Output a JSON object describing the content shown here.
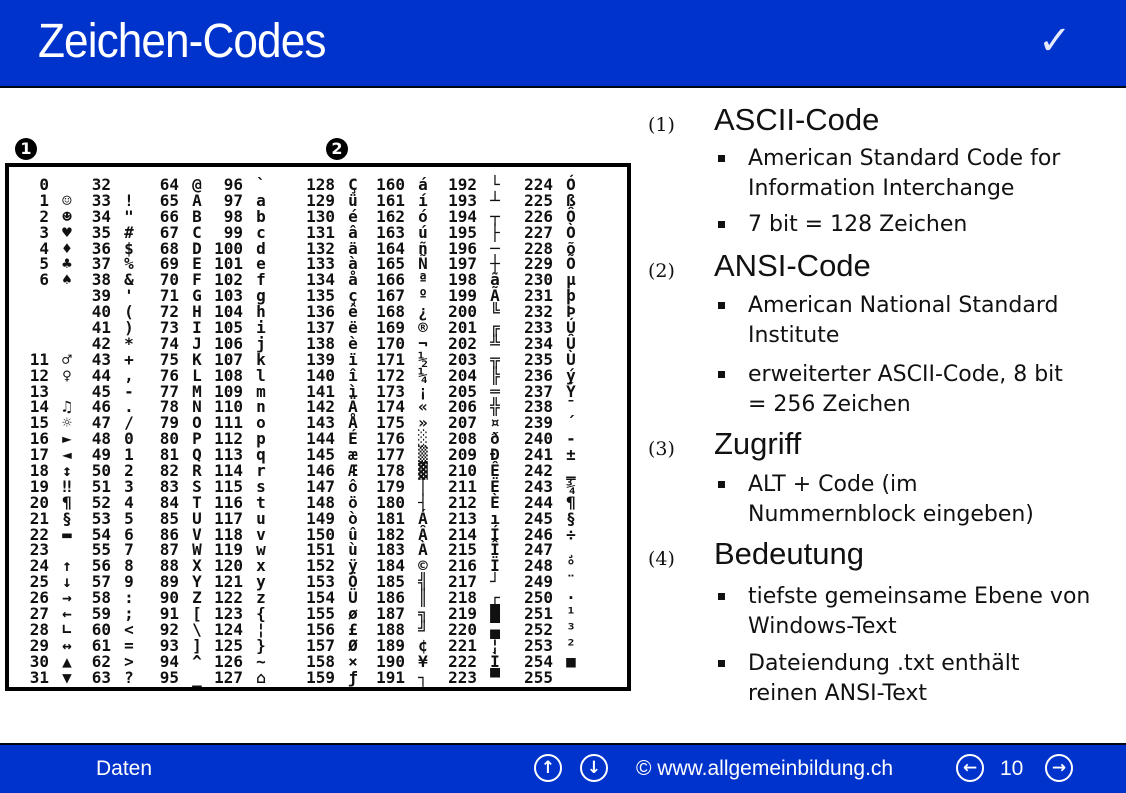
{
  "header": {
    "title": "Zeichen-Codes",
    "check_icon": "✓"
  },
  "markers": {
    "ascii": "1",
    "ansi": "2"
  },
  "code_table": {
    "columns": [
      [
        [
          "0",
          ""
        ],
        [
          "1",
          "☺"
        ],
        [
          "2",
          "☻"
        ],
        [
          "3",
          "♥"
        ],
        [
          "4",
          "♦"
        ],
        [
          "5",
          "♣"
        ],
        [
          "6",
          "♠"
        ],
        [
          "",
          ""
        ],
        [
          "",
          ""
        ],
        [
          "",
          ""
        ],
        [
          "",
          ""
        ],
        [
          "11",
          "♂"
        ],
        [
          "12",
          "♀"
        ],
        [
          "13",
          ""
        ],
        [
          "14",
          "♫"
        ],
        [
          "15",
          "☼"
        ],
        [
          "16",
          "►"
        ],
        [
          "17",
          "◄"
        ],
        [
          "18",
          "↕"
        ],
        [
          "19",
          "‼"
        ],
        [
          "20",
          "¶"
        ],
        [
          "21",
          "§"
        ],
        [
          "22",
          "▬"
        ],
        [
          "23",
          ""
        ],
        [
          "24",
          "↑"
        ],
        [
          "25",
          "↓"
        ],
        [
          "26",
          "→"
        ],
        [
          "27",
          "←"
        ],
        [
          "28",
          "∟"
        ],
        [
          "29",
          "↔"
        ],
        [
          "30",
          "▲"
        ],
        [
          "31",
          "▼"
        ]
      ],
      [
        [
          "32",
          ""
        ],
        [
          "33",
          "!"
        ],
        [
          "34",
          "\""
        ],
        [
          "35",
          "#"
        ],
        [
          "36",
          "$"
        ],
        [
          "37",
          "%"
        ],
        [
          "38",
          "&"
        ],
        [
          "39",
          "'"
        ],
        [
          "40",
          "("
        ],
        [
          "41",
          ")"
        ],
        [
          "42",
          "*"
        ],
        [
          "43",
          "+"
        ],
        [
          "44",
          ","
        ],
        [
          "45",
          "-"
        ],
        [
          "46",
          "."
        ],
        [
          "47",
          "/"
        ],
        [
          "48",
          "0"
        ],
        [
          "49",
          "1"
        ],
        [
          "50",
          "2"
        ],
        [
          "51",
          "3"
        ],
        [
          "52",
          "4"
        ],
        [
          "53",
          "5"
        ],
        [
          "54",
          "6"
        ],
        [
          "55",
          "7"
        ],
        [
          "56",
          "8"
        ],
        [
          "57",
          "9"
        ],
        [
          "58",
          ":"
        ],
        [
          "59",
          ";"
        ],
        [
          "60",
          "<"
        ],
        [
          "61",
          "="
        ],
        [
          "62",
          ">"
        ],
        [
          "63",
          "?"
        ]
      ],
      [
        [
          "64",
          "@"
        ],
        [
          "65",
          "A"
        ],
        [
          "66",
          "B"
        ],
        [
          "67",
          "C"
        ],
        [
          "68",
          "D"
        ],
        [
          "69",
          "E"
        ],
        [
          "70",
          "F"
        ],
        [
          "71",
          "G"
        ],
        [
          "72",
          "H"
        ],
        [
          "73",
          "I"
        ],
        [
          "74",
          "J"
        ],
        [
          "75",
          "K"
        ],
        [
          "76",
          "L"
        ],
        [
          "77",
          "M"
        ],
        [
          "78",
          "N"
        ],
        [
          "79",
          "O"
        ],
        [
          "80",
          "P"
        ],
        [
          "81",
          "Q"
        ],
        [
          "82",
          "R"
        ],
        [
          "83",
          "S"
        ],
        [
          "84",
          "T"
        ],
        [
          "85",
          "U"
        ],
        [
          "86",
          "V"
        ],
        [
          "87",
          "W"
        ],
        [
          "88",
          "X"
        ],
        [
          "89",
          "Y"
        ],
        [
          "90",
          "Z"
        ],
        [
          "91",
          "["
        ],
        [
          "92",
          "\\"
        ],
        [
          "93",
          "]"
        ],
        [
          "94",
          "^"
        ],
        [
          "95",
          "_"
        ]
      ],
      [
        [
          "96",
          "`"
        ],
        [
          "97",
          "a"
        ],
        [
          "98",
          "b"
        ],
        [
          "99",
          "c"
        ],
        [
          "100",
          "d"
        ],
        [
          "101",
          "e"
        ],
        [
          "102",
          "f"
        ],
        [
          "103",
          "g"
        ],
        [
          "104",
          "h"
        ],
        [
          "105",
          "i"
        ],
        [
          "106",
          "j"
        ],
        [
          "107",
          "k"
        ],
        [
          "108",
          "l"
        ],
        [
          "109",
          "m"
        ],
        [
          "110",
          "n"
        ],
        [
          "111",
          "o"
        ],
        [
          "112",
          "p"
        ],
        [
          "113",
          "q"
        ],
        [
          "114",
          "r"
        ],
        [
          "115",
          "s"
        ],
        [
          "116",
          "t"
        ],
        [
          "117",
          "u"
        ],
        [
          "118",
          "v"
        ],
        [
          "119",
          "w"
        ],
        [
          "120",
          "x"
        ],
        [
          "121",
          "y"
        ],
        [
          "122",
          "z"
        ],
        [
          "123",
          "{"
        ],
        [
          "124",
          "¦"
        ],
        [
          "125",
          "}"
        ],
        [
          "126",
          "~"
        ],
        [
          "127",
          "⌂"
        ]
      ],
      [
        [
          "128",
          "Ç"
        ],
        [
          "129",
          "ü"
        ],
        [
          "130",
          "é"
        ],
        [
          "131",
          "â"
        ],
        [
          "132",
          "ä"
        ],
        [
          "133",
          "à"
        ],
        [
          "134",
          "å"
        ],
        [
          "135",
          "ç"
        ],
        [
          "136",
          "ê"
        ],
        [
          "137",
          "ë"
        ],
        [
          "138",
          "è"
        ],
        [
          "139",
          "ï"
        ],
        [
          "140",
          "î"
        ],
        [
          "141",
          "ì"
        ],
        [
          "142",
          "Ä"
        ],
        [
          "143",
          "Å"
        ],
        [
          "144",
          "É"
        ],
        [
          "145",
          "æ"
        ],
        [
          "146",
          "Æ"
        ],
        [
          "147",
          "ô"
        ],
        [
          "148",
          "ö"
        ],
        [
          "149",
          "ò"
        ],
        [
          "150",
          "û"
        ],
        [
          "151",
          "ù"
        ],
        [
          "152",
          "ÿ"
        ],
        [
          "153",
          "Ö"
        ],
        [
          "154",
          "Ü"
        ],
        [
          "155",
          "ø"
        ],
        [
          "156",
          "£"
        ],
        [
          "157",
          "Ø"
        ],
        [
          "158",
          "×"
        ],
        [
          "159",
          "ƒ"
        ]
      ],
      [
        [
          "160",
          "á"
        ],
        [
          "161",
          "í"
        ],
        [
          "162",
          "ó"
        ],
        [
          "163",
          "ú"
        ],
        [
          "164",
          "ñ"
        ],
        [
          "165",
          "Ñ"
        ],
        [
          "166",
          "ª"
        ],
        [
          "167",
          "º"
        ],
        [
          "168",
          "¿"
        ],
        [
          "169",
          "®"
        ],
        [
          "170",
          "¬"
        ],
        [
          "171",
          "½"
        ],
        [
          "172",
          "¼"
        ],
        [
          "173",
          "¡"
        ],
        [
          "174",
          "«"
        ],
        [
          "175",
          "»"
        ],
        [
          "176",
          "░"
        ],
        [
          "177",
          "▒"
        ],
        [
          "178",
          "▓"
        ],
        [
          "179",
          "│"
        ],
        [
          "180",
          "┤"
        ],
        [
          "181",
          "Á"
        ],
        [
          "182",
          "Â"
        ],
        [
          "183",
          "À"
        ],
        [
          "184",
          "©"
        ],
        [
          "185",
          "╣"
        ],
        [
          "186",
          "║"
        ],
        [
          "187",
          "╗"
        ],
        [
          "188",
          "╝"
        ],
        [
          "189",
          "¢"
        ],
        [
          "190",
          "¥"
        ],
        [
          "191",
          "┐"
        ]
      ],
      [
        [
          "192",
          "└"
        ],
        [
          "193",
          "┴"
        ],
        [
          "194",
          "┬"
        ],
        [
          "195",
          "├"
        ],
        [
          "196",
          "─"
        ],
        [
          "197",
          "┼"
        ],
        [
          "198",
          "ã"
        ],
        [
          "199",
          "Ã"
        ],
        [
          "200",
          "╚"
        ],
        [
          "201",
          "╔"
        ],
        [
          "202",
          "╩"
        ],
        [
          "203",
          "╦"
        ],
        [
          "204",
          "╠"
        ],
        [
          "205",
          "═"
        ],
        [
          "206",
          "╬"
        ],
        [
          "207",
          "¤"
        ],
        [
          "208",
          "ð"
        ],
        [
          "209",
          "Ð"
        ],
        [
          "210",
          "Ê"
        ],
        [
          "211",
          "Ë"
        ],
        [
          "212",
          "È"
        ],
        [
          "213",
          "ı"
        ],
        [
          "214",
          "Í"
        ],
        [
          "215",
          "Î"
        ],
        [
          "216",
          "Ï"
        ],
        [
          "217",
          "┘"
        ],
        [
          "218",
          "┌"
        ],
        [
          "219",
          "█"
        ],
        [
          "220",
          "▄"
        ],
        [
          "221",
          "¦"
        ],
        [
          "222",
          "Ì"
        ],
        [
          "223",
          "▀"
        ]
      ],
      [
        [
          "224",
          "Ó"
        ],
        [
          "225",
          "ß"
        ],
        [
          "226",
          "Ô"
        ],
        [
          "227",
          "Ò"
        ],
        [
          "228",
          "õ"
        ],
        [
          "229",
          "Õ"
        ],
        [
          "230",
          "µ"
        ],
        [
          "231",
          "þ"
        ],
        [
          "232",
          "Þ"
        ],
        [
          "233",
          "Ú"
        ],
        [
          "234",
          "Û"
        ],
        [
          "235",
          "Ù"
        ],
        [
          "236",
          "ý"
        ],
        [
          "237",
          "Ý"
        ],
        [
          "238",
          "¯"
        ],
        [
          "239",
          "´"
        ],
        [
          "240",
          "-"
        ],
        [
          "241",
          "±"
        ],
        [
          "242",
          "‗"
        ],
        [
          "243",
          "¾"
        ],
        [
          "244",
          "¶"
        ],
        [
          "245",
          "§"
        ],
        [
          "246",
          "÷"
        ],
        [
          "247",
          "¸"
        ],
        [
          "248",
          "°"
        ],
        [
          "249",
          "¨"
        ],
        [
          "250",
          "·"
        ],
        [
          "251",
          "¹"
        ],
        [
          "252",
          "³"
        ],
        [
          "253",
          "²"
        ],
        [
          "254",
          "■"
        ],
        [
          "255",
          ""
        ]
      ]
    ]
  },
  "notes": {
    "sections": [
      {
        "index": "(1)",
        "heading": "ASCII-Code",
        "bullets": [
          "American Standard Code for Information Interchange",
          "7 bit = 128 Zeichen"
        ]
      },
      {
        "index": "(2)",
        "heading": "ANSI-Code",
        "bullets": [
          "American National Standard Institute",
          "erweiterter ASCII-Code, 8 bit = 256 Zeichen"
        ]
      },
      {
        "index": "(3)",
        "heading": "Zugriff",
        "bullets": [
          "ALT + Code (im Nummernblock eingeben)"
        ]
      },
      {
        "index": "(4)",
        "heading": "Bedeutung",
        "bullets": [
          "tiefste gemeinsame Ebene von Windows-Text",
          "Dateiendung .txt enthält reinen ANSI-Text"
        ]
      }
    ]
  },
  "footer": {
    "section_name": "Daten",
    "up_icon": "🡡",
    "down_icon": "🡣",
    "copyright": "© www.allgemeinbildung.ch",
    "prev_icon": "←",
    "page_number": "10",
    "next_icon": "→"
  },
  "colors": {
    "brand_blue": "#0033cc",
    "text": "#111111"
  }
}
